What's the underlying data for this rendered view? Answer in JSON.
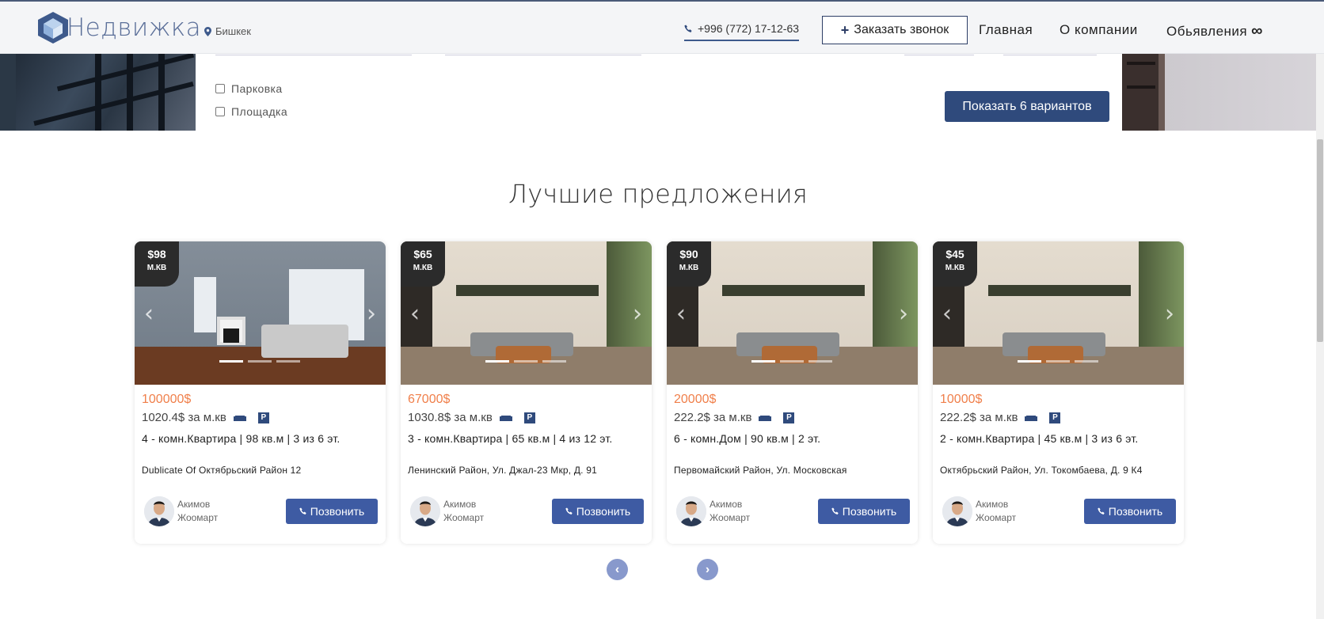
{
  "header": {
    "logo_text": "Недвижка",
    "city": "Бишкек",
    "phone": "+996 (772) 17-12-63",
    "callback_label": "Заказать звонок",
    "nav": [
      "Главная",
      "О компании",
      "Обьявления"
    ]
  },
  "filters": {
    "checkboxes": [
      "Парковка",
      "Площадка"
    ],
    "show_button": "Показать 6 вариантов"
  },
  "section": {
    "title": "Лучшие предложения"
  },
  "listings": [
    {
      "badge_price": "$98",
      "badge_unit": "М.КВ",
      "price": "100000$",
      "per_sqm": "1020.4$ за м.кв",
      "summary": "4 - комн.Квартира | 98 кв.м | 3 из 6 эт.",
      "address": "Dublicate Of Октябрьский Район 12",
      "agent_first": "Акимов",
      "agent_last": "Жоомарт",
      "call_label": "Позвонить",
      "parking_label": "P"
    },
    {
      "badge_price": "$65",
      "badge_unit": "М.КВ",
      "price": "67000$",
      "per_sqm": "1030.8$ за м.кв",
      "summary": "3 - комн.Квартира | 65 кв.м | 4 из 12 эт.",
      "address": "Ленинский Район, Ул. Джал-23 Мкр, Д. 91",
      "agent_first": "Акимов",
      "agent_last": "Жоомарт",
      "call_label": "Позвонить",
      "parking_label": "P"
    },
    {
      "badge_price": "$90",
      "badge_unit": "М.КВ",
      "price": "20000$",
      "per_sqm": "222.2$ за м.кв",
      "summary": "6 - комн.Дом | 90 кв.м | 2 эт.",
      "address": "Первомайский Район, Ул. Московская",
      "agent_first": "Акимов",
      "agent_last": "Жоомарт",
      "call_label": "Позвонить",
      "parking_label": "P"
    },
    {
      "badge_price": "$45",
      "badge_unit": "М.КВ",
      "price": "10000$",
      "per_sqm": "222.2$ за м.кв",
      "summary": "2 - комн.Квартира | 45 кв.м | 3 из 6 эт.",
      "address": "Октябрьский Район, Ул. Токомбаева, Д. 9 К4",
      "agent_first": "Акимов",
      "agent_last": "Жоомарт",
      "call_label": "Позвонить",
      "parking_label": "P"
    }
  ],
  "colors": {
    "brand": "#2f4a7c",
    "price": "#f07f4a",
    "call_button": "#3e5ba3",
    "pager": "#8899cc"
  }
}
